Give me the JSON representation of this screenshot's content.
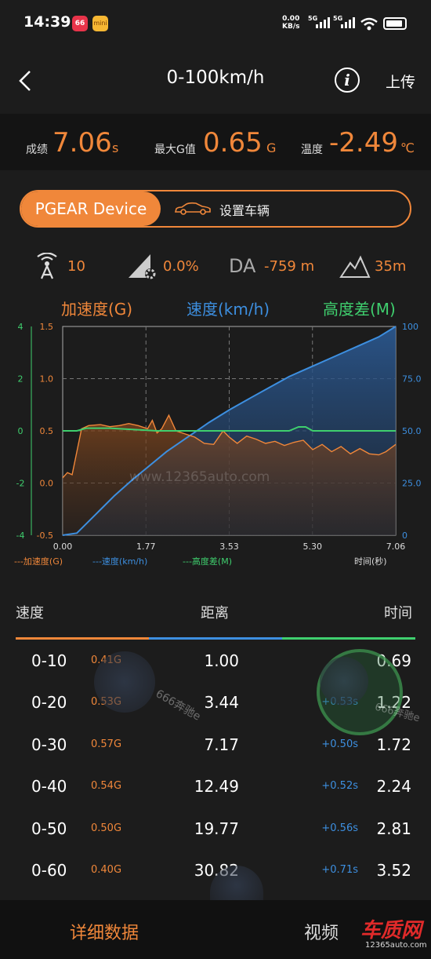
{
  "status_bar": {
    "time": "14:39",
    "app1": "66",
    "app2": "mini",
    "net_speed": "0.00",
    "net_unit": "KB/s",
    "sim1": "5G",
    "sim2": "5G"
  },
  "header": {
    "title": "0-100km/h",
    "upload": "上传"
  },
  "results": {
    "score_label": "成绩",
    "score_value": "7.06",
    "score_unit": "s",
    "g_label": "最大G值",
    "g_value": "0.65",
    "g_unit": "G",
    "temp_label": "温度",
    "temp_value": "-2.49",
    "temp_unit": "℃"
  },
  "toggle": {
    "active": "PGEAR Device",
    "inactive": "设置车辆"
  },
  "stats": {
    "satellites": "10",
    "slope": "0.0%",
    "da_label": "DA",
    "da_value": "-759 m",
    "altitude": "35m"
  },
  "chart_data": {
    "type": "line",
    "axis_titles": {
      "accel": "加速度(G)",
      "speed": "速度(km/h)",
      "height": "高度差(M)"
    },
    "colors": {
      "accel": "#f0873a",
      "speed": "#3d8fe0",
      "height": "#3fcf6e"
    },
    "x_ticks": [
      "0.00",
      "1.77",
      "3.53",
      "5.30",
      "7.06"
    ],
    "xlim": [
      0,
      7.06
    ],
    "height_ticks": [
      "4",
      "2",
      "0",
      "-2",
      "-4"
    ],
    "accel_ticks": [
      "1.5",
      "1.0",
      "0.5",
      "0.0",
      "-0.5"
    ],
    "speed_ticks": [
      "100",
      "75.0",
      "50.0",
      "25.0",
      "0"
    ],
    "accel_ylim": [
      -0.5,
      1.5
    ],
    "speed_ylim": [
      0,
      100
    ],
    "height_ylim": [
      -4,
      4
    ],
    "legend": {
      "accel": "---加速度(G)",
      "speed": "---速度(km/h)",
      "height": "---高度差(M)",
      "xlabel": "时间(秒)"
    },
    "series": [
      {
        "name": "速度(km/h)",
        "x": [
          0,
          0.3,
          0.7,
          1.1,
          1.5,
          1.77,
          2.2,
          2.65,
          3.1,
          3.53,
          4.0,
          4.4,
          4.8,
          5.3,
          5.8,
          6.3,
          6.7,
          7.06
        ],
        "values": [
          0,
          1,
          10,
          19,
          27,
          32,
          40,
          47,
          54,
          60,
          66,
          71,
          76,
          81,
          86,
          91,
          95,
          100
        ]
      },
      {
        "name": "加速度(G)",
        "x": [
          0,
          0.1,
          0.2,
          0.3,
          0.4,
          0.55,
          0.8,
          1.0,
          1.2,
          1.4,
          1.6,
          1.8,
          1.9,
          2.0,
          2.1,
          2.25,
          2.4,
          2.6,
          2.8,
          3.0,
          3.2,
          3.4,
          3.53,
          3.7,
          3.9,
          4.1,
          4.3,
          4.5,
          4.7,
          4.9,
          5.1,
          5.3,
          5.5,
          5.7,
          5.9,
          6.1,
          6.3,
          6.5,
          6.7,
          6.85,
          7.06
        ],
        "values": [
          0.05,
          0.1,
          0.08,
          0.3,
          0.52,
          0.55,
          0.56,
          0.54,
          0.55,
          0.57,
          0.55,
          0.52,
          0.6,
          0.48,
          0.52,
          0.65,
          0.5,
          0.47,
          0.44,
          0.38,
          0.37,
          0.5,
          0.44,
          0.38,
          0.45,
          0.42,
          0.38,
          0.4,
          0.36,
          0.39,
          0.41,
          0.32,
          0.37,
          0.3,
          0.35,
          0.28,
          0.33,
          0.28,
          0.27,
          0.3,
          0.37
        ]
      },
      {
        "name": "高度差(M)",
        "x": [
          0,
          0.3,
          0.5,
          1.0,
          2.0,
          3.0,
          4.0,
          4.8,
          5.0,
          5.15,
          5.3,
          6.0,
          7.06
        ],
        "values": [
          0,
          0,
          0.1,
          0.1,
          0,
          0,
          0,
          0,
          0.15,
          0.15,
          0,
          0,
          0
        ]
      }
    ]
  },
  "table": {
    "headers": {
      "speed": "速度",
      "distance": "距离",
      "time": "时间"
    },
    "rows": [
      {
        "speed": "0-10",
        "g": "0.41G",
        "distance": "1.00",
        "delta": "",
        "time": "0.69"
      },
      {
        "speed": "0-20",
        "g": "0.53G",
        "distance": "3.44",
        "delta": "+0.53s",
        "time": "1.22"
      },
      {
        "speed": "0-30",
        "g": "0.57G",
        "distance": "7.17",
        "delta": "+0.50s",
        "time": "1.72"
      },
      {
        "speed": "0-40",
        "g": "0.54G",
        "distance": "12.49",
        "delta": "+0.52s",
        "time": "2.24"
      },
      {
        "speed": "0-50",
        "g": "0.50G",
        "distance": "19.77",
        "delta": "+0.56s",
        "time": "2.81"
      },
      {
        "speed": "0-60",
        "g": "0.40G",
        "distance": "30.82",
        "delta": "+0.71s",
        "time": "3.52"
      }
    ]
  },
  "watermark": {
    "text1": "www.12365auto.com",
    "text2": "666奔驰e",
    "text3": "666奔驰e",
    "logo": "车质网",
    "logo_url": "12365auto.com"
  },
  "bottom_nav": {
    "detail": "详细数据",
    "video": "视频"
  }
}
